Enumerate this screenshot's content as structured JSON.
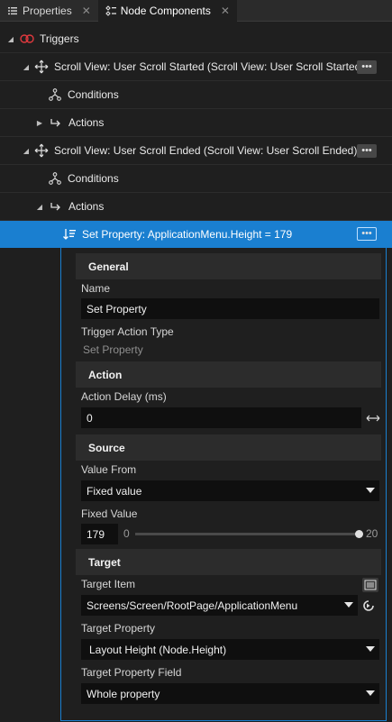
{
  "tabs": [
    {
      "label": "Properties",
      "icon": "list-icon",
      "active": false
    },
    {
      "label": "Node Components",
      "icon": "node-components-icon",
      "active": true
    }
  ],
  "tree": {
    "triggers_label": "Triggers",
    "trigger1": {
      "label": "Scroll View: User Scroll Started (Scroll View: User Scroll Started)",
      "conditions_label": "Conditions",
      "actions_label": "Actions"
    },
    "trigger2": {
      "label": "Scroll View: User Scroll Ended (Scroll View: User Scroll Ended)",
      "conditions_label": "Conditions",
      "actions_label": "Actions"
    },
    "selected_action": "Set Property: ApplicationMenu.Height = 179",
    "more_label": "•••"
  },
  "panel": {
    "general": {
      "title": "General",
      "name_label": "Name",
      "name_value": "Set Property",
      "type_label": "Trigger Action Type",
      "type_value": "Set Property"
    },
    "action": {
      "title": "Action",
      "delay_label": "Action Delay (ms)",
      "delay_value": "0"
    },
    "source": {
      "title": "Source",
      "value_from_label": "Value From",
      "value_from_selected": "Fixed value",
      "fixed_value_label": "Fixed Value",
      "fixed_value": "179",
      "slider_min": "0",
      "slider_max": "20",
      "slider_level": 1.0
    },
    "target": {
      "title": "Target",
      "item_label": "Target Item",
      "item_value": "Screens/Screen/RootPage/ApplicationMenu",
      "property_label": "Target Property",
      "property_value": "Layout Height (Node.Height)",
      "field_label": "Target Property Field",
      "field_value": "Whole property"
    }
  },
  "colors": {
    "accent": "#1a7fd0",
    "trigger_red": "#e0393e"
  }
}
